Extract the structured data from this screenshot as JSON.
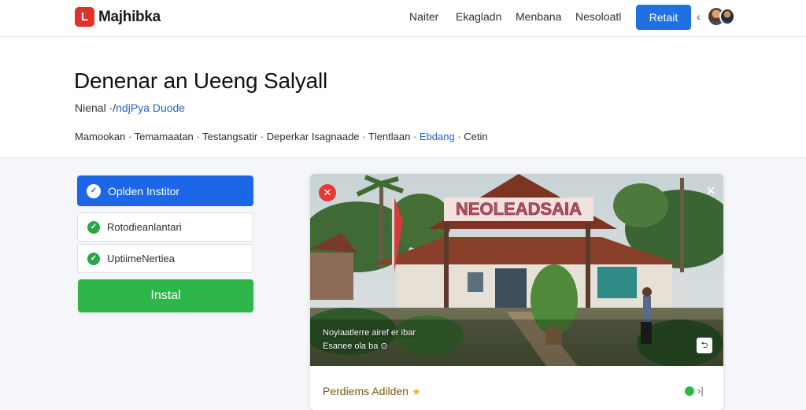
{
  "nav": {
    "logo_letter": "L",
    "brand": "Majhibka",
    "links": [
      "Naiter",
      "Ekagladn",
      "Menbana",
      "Nesoloatl"
    ],
    "cta": "Retait",
    "chevron": "‹",
    "colors": {
      "accent": "#1f6fe5",
      "logo": "#e0312b"
    }
  },
  "header": {
    "title": "Denenar an Ueeng Salyall",
    "subtitle_text": "Nienal ·/",
    "subtitle_link": "ndjPya Duode",
    "breadcrumb_text": "Mamookan · Temamaatan · Testangsatir · Deperkar Isagnaade · Tlentlaan ·",
    "breadcrumb_link": "Ebdang",
    "breadcrumb_tail": " · Cetin"
  },
  "options": {
    "primary": "Oplden Institor",
    "items": [
      "Rotodieanlantari",
      "UptiimeNertiea"
    ],
    "install": "Instal",
    "colors": {
      "primary": "#1c66e8",
      "install": "#2fb64a"
    }
  },
  "card": {
    "sign_text": "NEOLEADSAIA",
    "caption_1": "Noyiaatlerre airef er ibar",
    "caption_2": "Esanee ola ba ⊙",
    "mini_button": "⮌",
    "footer_label": "Perdiems Adilden",
    "footer_icon": "star-icon",
    "next_label": "›|"
  }
}
